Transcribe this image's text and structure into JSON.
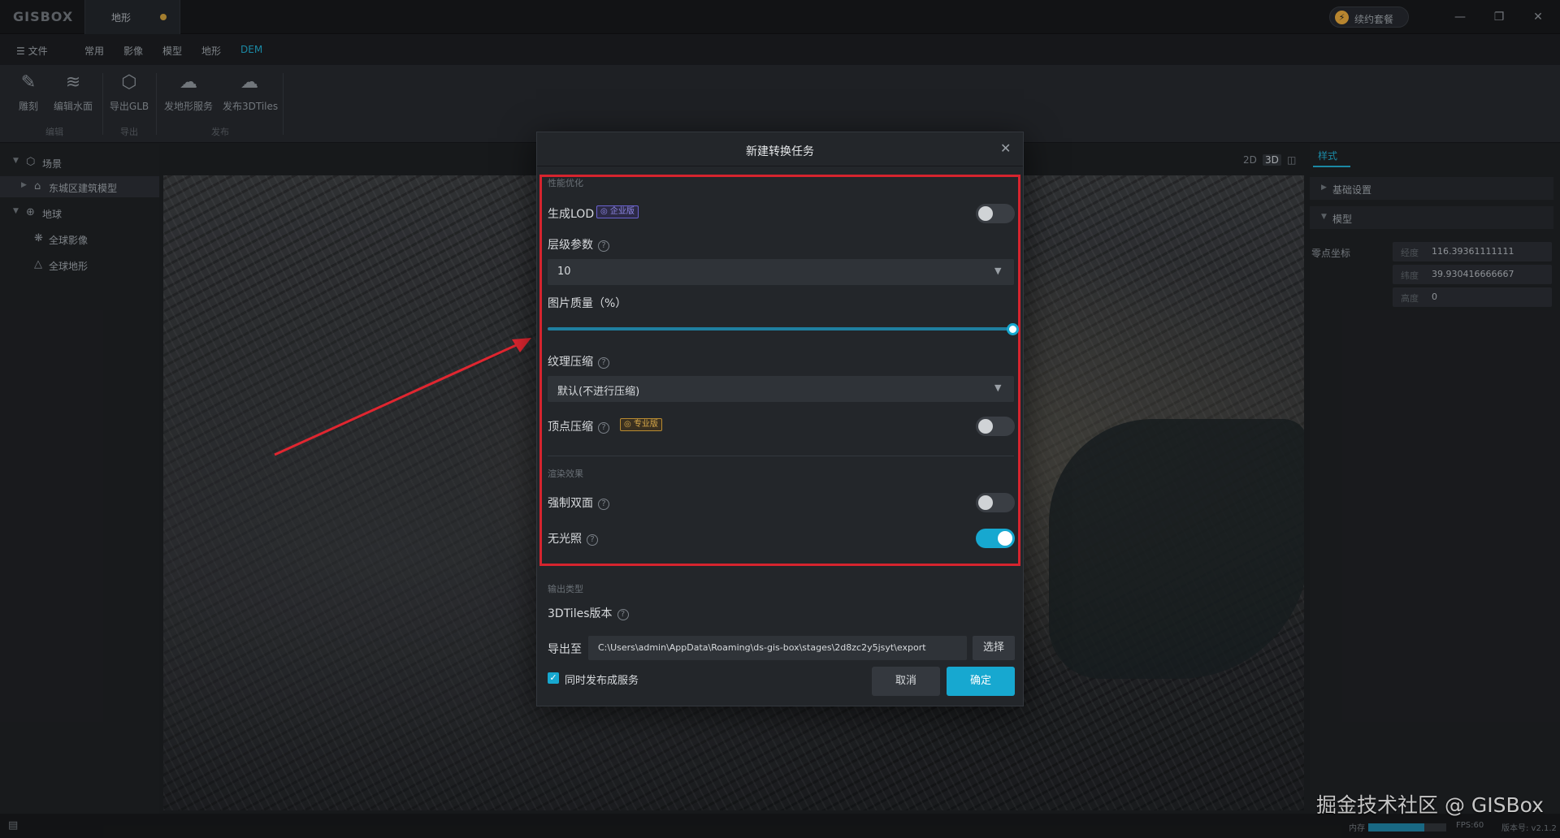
{
  "app": {
    "logo": "GISBOX",
    "doc_tab": "地形",
    "renew_label": "续约套餐",
    "renew_icon": "lightning-icon"
  },
  "window_controls": [
    "minimize-icon",
    "restore-icon",
    "close-icon"
  ],
  "menu": {
    "file": "文件",
    "items": [
      "常用",
      "影像",
      "模型",
      "地形",
      "DEM"
    ],
    "active": "DEM"
  },
  "ribbon": {
    "buttons": [
      {
        "label": "雕刻",
        "icon": "sculpt-icon"
      },
      {
        "label": "编辑水面",
        "icon": "water-edit-icon"
      },
      {
        "label": "导出GLB",
        "icon": "export-glb-icon"
      },
      {
        "label": "发地形服务",
        "icon": "cloud-upload-icon"
      },
      {
        "label": "发布3DTiles",
        "icon": "cloud-upload-icon"
      }
    ],
    "groups": [
      "编辑",
      "导出",
      "发布"
    ]
  },
  "tree": {
    "scene": "场景",
    "scene_child": "东城区建筑模型",
    "globe": "地球",
    "globe_children": [
      "全球影像",
      "全球地形"
    ]
  },
  "view_modes": [
    "2D",
    "3D",
    "split"
  ],
  "right_panel": {
    "tab": "样式",
    "sections": [
      "基础设置",
      "模型"
    ],
    "coord_label": "零点坐标",
    "coords": [
      {
        "key": "经度",
        "value": "116.39361111111"
      },
      {
        "key": "纬度",
        "value": "39.930416666667"
      },
      {
        "key": "高度",
        "value": "0"
      }
    ]
  },
  "status": {
    "memory_label": "内存",
    "memory_fraction": 0.72,
    "fps": "FPS:60",
    "version": "版本号: v2.1.2"
  },
  "watermark": "掘金技术社区 @ GISBox",
  "modal": {
    "title": "新建转换任务",
    "perf_section": "性能优化",
    "gen_lod": "生成LOD",
    "gen_lod_badge": "企业版",
    "gen_lod_on": false,
    "level_params": "层级参数",
    "level_value": "10",
    "img_quality": "图片质量（%）",
    "img_quality_value": 100,
    "texture_compress": "纹理压缩",
    "texture_value": "默认(不进行压缩)",
    "vertex_compress": "顶点压缩",
    "vertex_badge": "专业版",
    "vertex_on": false,
    "render_section": "渲染效果",
    "double_side": "强制双面",
    "double_side_on": false,
    "no_light": "无光照",
    "no_light_on": true,
    "output_section": "输出类型",
    "tiles_version": "3DTiles版本",
    "export_to": "导出至",
    "export_path": "C:\\Users\\admin\\AppData\\Roaming\\ds-gis-box\\stages\\2d8zc2y5jsyt\\export",
    "choose": "选择",
    "publish_service": "同时发布成服务",
    "cancel": "取消",
    "ok": "确定"
  }
}
